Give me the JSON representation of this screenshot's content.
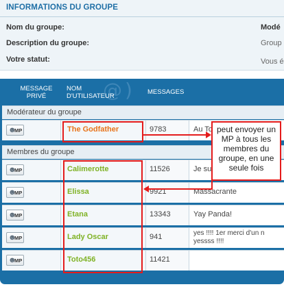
{
  "info": {
    "title": "INFORMATIONS DU GROUPE",
    "fields": [
      {
        "label": "Nom du groupe:",
        "value": "Modé"
      },
      {
        "label": "Description du groupe:",
        "value": "Group"
      },
      {
        "label": "Votre statut:",
        "value": "Vous é"
      }
    ]
  },
  "table": {
    "headers": {
      "mp": "MESSAGE PRIVÉ",
      "user": "NOM D'UTILISATEUR",
      "messages": "MESSAGES"
    },
    "mp_button_label": "MP",
    "moderators": {
      "label": "Modérateur du groupe",
      "rows": [
        {
          "name": "The Godfather",
          "count": "9783",
          "message": "Au To",
          "name_color": "#e8731a"
        }
      ]
    },
    "members": {
      "label": "Membres du groupe",
      "rows": [
        {
          "name": "Calimerotte",
          "count": "11526",
          "message": "Je su",
          "name_color": "#7fb225"
        },
        {
          "name": "Elissa",
          "count": "9921",
          "message": "Massacrante",
          "name_color": "#7fb225"
        },
        {
          "name": "Etana",
          "count": "13343",
          "message": "Yay Panda!",
          "name_color": "#7fb225"
        },
        {
          "name": "Lady Oscar",
          "count": "941",
          "message_line1": "yes !!!! 1er merci d'un n",
          "message_line2": "yessss !!!!",
          "name_color": "#7fb225"
        },
        {
          "name": "Toto456",
          "count": "11421",
          "message": "",
          "name_color": "#7fb225"
        }
      ]
    }
  },
  "annotation": {
    "callout_text": "peut envoyer un MP à tous les membres du groupe, en une seule fois",
    "color": "#e41b1b"
  }
}
